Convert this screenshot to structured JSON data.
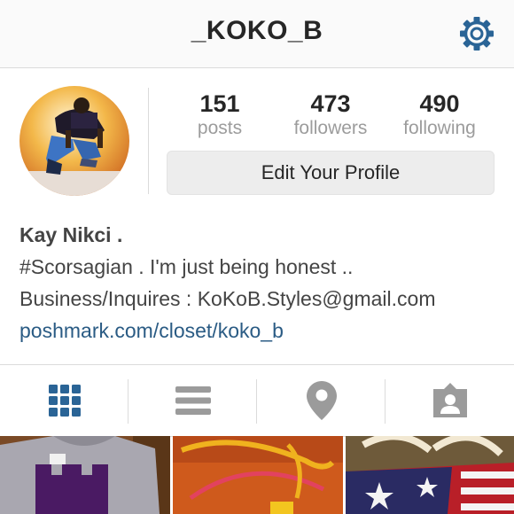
{
  "header": {
    "username": "_KOKO_B",
    "settings_icon": "gear-icon",
    "accent_color": "#2a6496"
  },
  "profile": {
    "avatar_icon": "profile-photo",
    "stats": [
      {
        "value": "151",
        "label": "posts"
      },
      {
        "value": "473",
        "label": "followers"
      },
      {
        "value": "490",
        "label": "following"
      }
    ],
    "edit_button_label": "Edit Your Profile",
    "full_name": "Kay Nikci .",
    "bio_lines": [
      "#Scorsagian . I'm just being honest ..",
      "Business/Inquires : KoKoB.Styles@gmail.com"
    ],
    "link": "poshmark.com/closet/koko_b"
  },
  "tabs": [
    {
      "name": "grid-view",
      "icon": "grid-icon",
      "active": true
    },
    {
      "name": "list-view",
      "icon": "list-icon",
      "active": false
    },
    {
      "name": "map-view",
      "icon": "location-pin-icon",
      "active": false
    },
    {
      "name": "tagged-view",
      "icon": "tagged-person-icon",
      "active": false
    }
  ],
  "colors": {
    "active_tab": "#2a6496",
    "inactive_tab": "#9b9b9b",
    "link": "#2a5b84",
    "button_bg": "#ededed"
  }
}
